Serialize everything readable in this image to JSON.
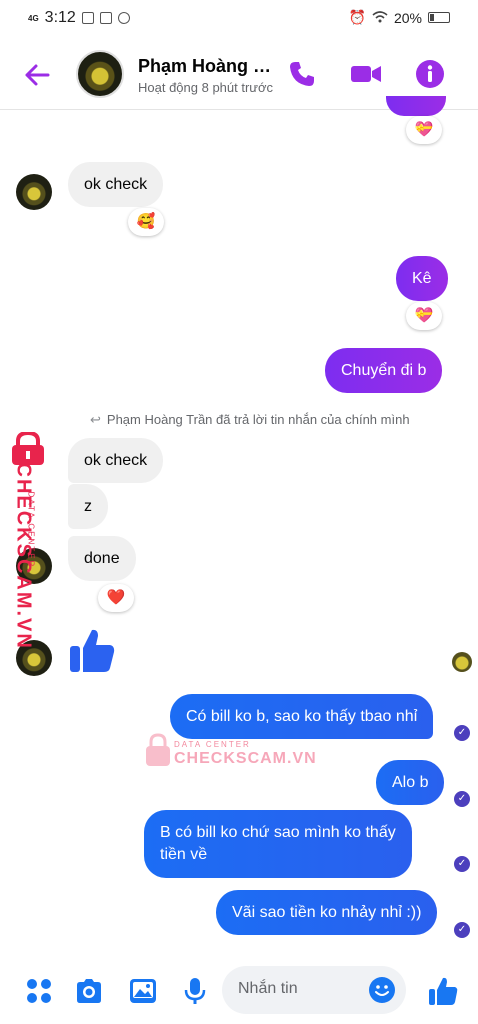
{
  "status_bar": {
    "network": "4G",
    "time": "3:12",
    "battery": "20%"
  },
  "header": {
    "name": "Phạm Hoàng Tr...",
    "status": "Hoạt động 8 phút trước"
  },
  "messages": {
    "m1": {
      "text": "ok check",
      "reaction": "🥰"
    },
    "m2": {
      "text": "Kê",
      "reaction": "💝"
    },
    "m3": {
      "text": "Chuyển đi b"
    },
    "reply_note": "Phạm Hoàng Trần đã trả lời tin nhắn của chính mình",
    "m4": {
      "text": "ok check"
    },
    "m5": {
      "text": "z"
    },
    "m6": {
      "text": "done",
      "reaction": "❤️"
    },
    "m7": {
      "text": "👍"
    },
    "m8": {
      "text": "Có bill ko b, sao ko thấy tbao nhỉ"
    },
    "m9": {
      "text": "Alo b"
    },
    "m10": {
      "line1": "B có bill ko chứ sao mình ko thấy",
      "line2": "tiền về"
    },
    "m11": {
      "text": "Vãi sao tiền ko nhảy nhỉ :))"
    },
    "top_reaction": "💝"
  },
  "watermark": {
    "brand": "CHECKSCAM.VN",
    "tag": "DATA CENTER"
  },
  "composer": {
    "placeholder": "Nhắn tin"
  },
  "colors": {
    "accent": "#9b2de6",
    "blue": "#1877f2",
    "watermark": "#e8244c"
  },
  "icons": [
    "back-arrow-icon",
    "phone-icon",
    "video-icon",
    "info-icon",
    "grid-icon",
    "camera-icon",
    "image-icon",
    "mic-icon",
    "emoji-icon",
    "like-icon"
  ]
}
